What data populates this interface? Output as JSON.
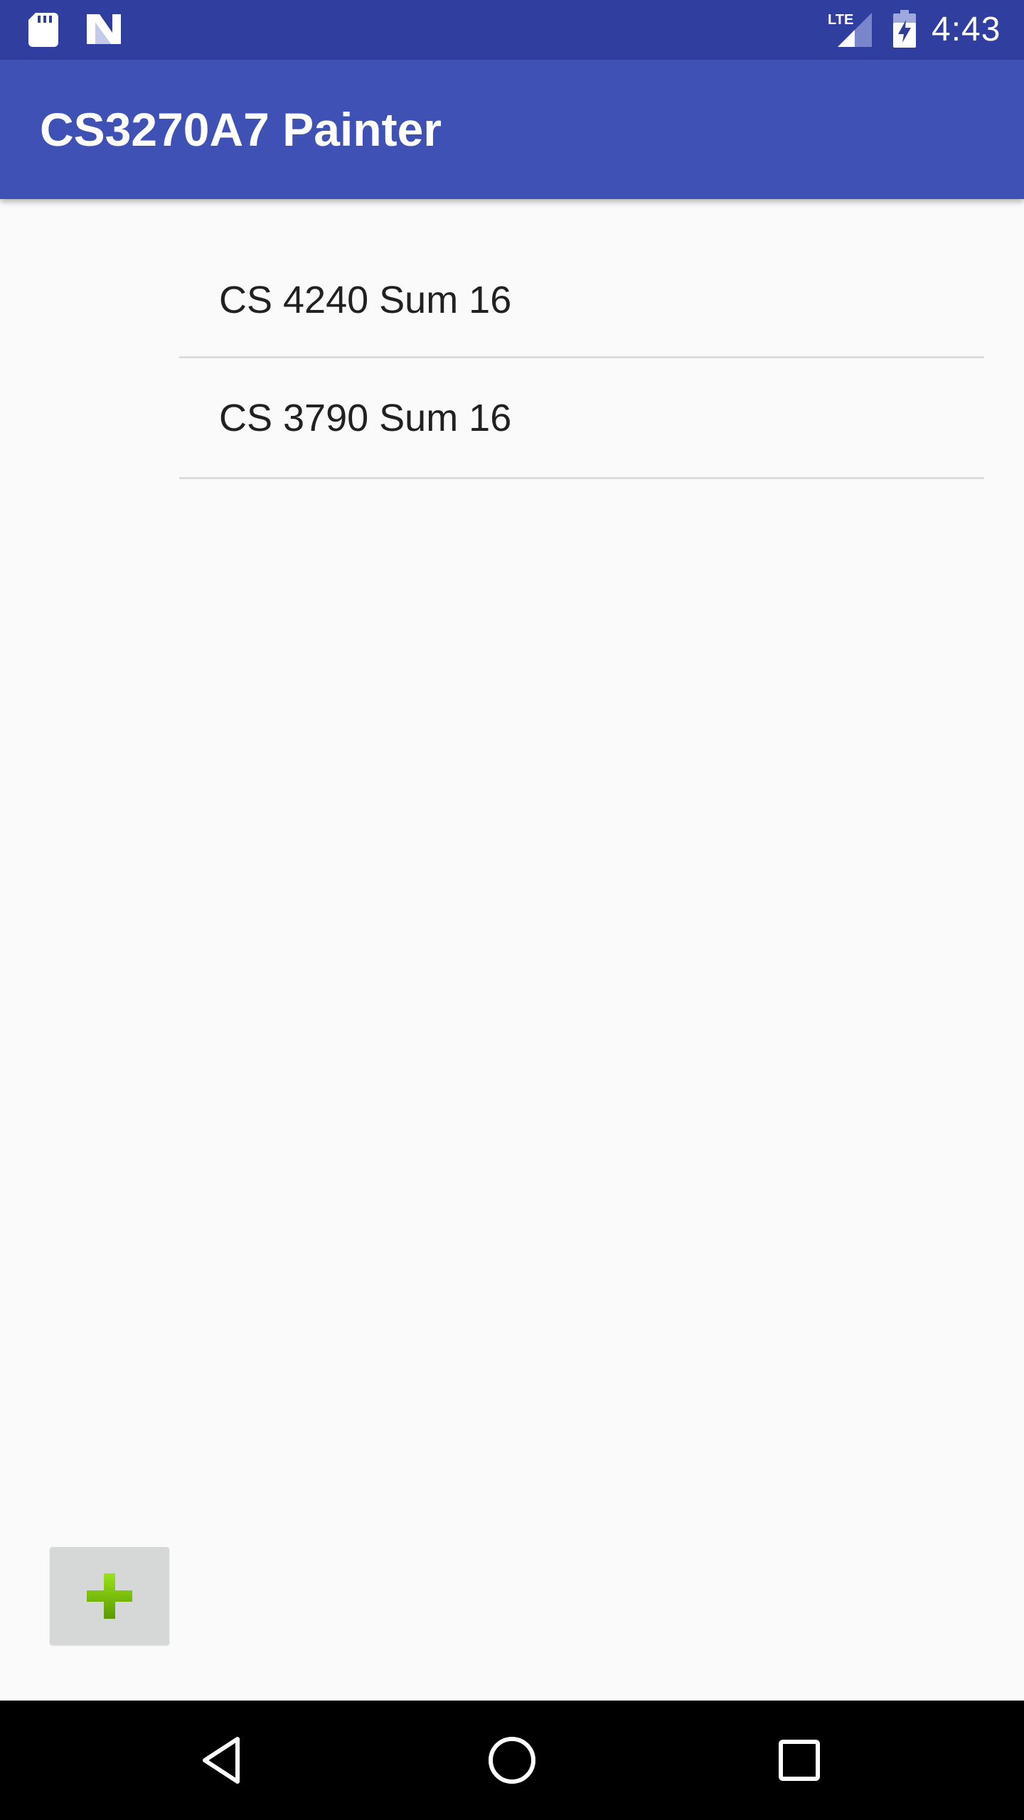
{
  "status_bar": {
    "icons": [
      "sd-card-icon",
      "n-logo-icon",
      "lte-signal-icon",
      "battery-charging-icon"
    ],
    "network_label": "LTE",
    "time": "4:43"
  },
  "app_bar": {
    "title": "CS3270A7 Painter"
  },
  "courses": {
    "items": [
      {
        "label": "CS 4240 Sum 16"
      },
      {
        "label": "CS 3790 Sum 16"
      }
    ]
  },
  "add_button": {
    "icon": "plus-icon"
  },
  "nav_bar": {
    "icons": [
      "back-icon",
      "home-icon",
      "recents-icon"
    ]
  },
  "colors": {
    "status_bar": "#303f9f",
    "app_bar": "#3f51b5",
    "background": "#fafafa",
    "divider": "#dcdcdc",
    "plus_green": "#7cc400"
  }
}
